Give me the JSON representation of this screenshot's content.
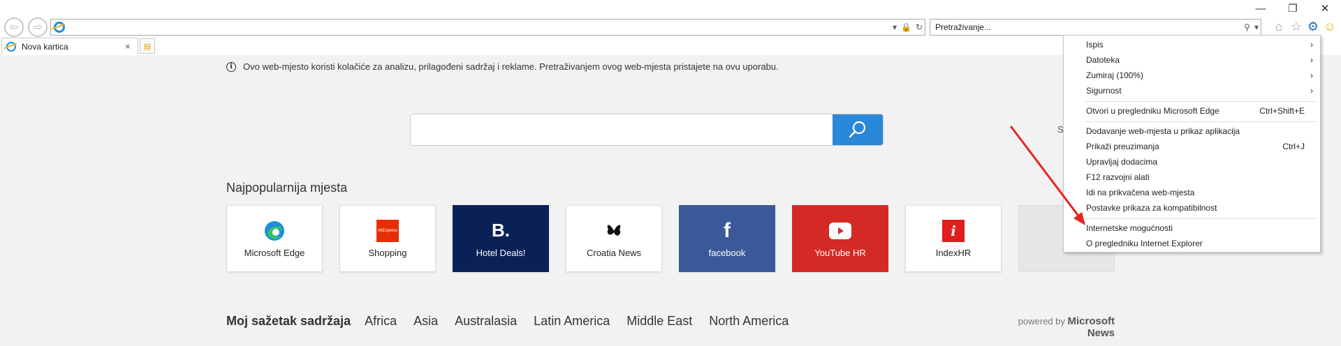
{
  "browser": {
    "address_value": "",
    "search_placeholder": "Pretraživanje...",
    "tab_title": "Nova kartica",
    "tab_close": "×",
    "window_controls": [
      "—",
      "❐",
      "✕"
    ],
    "icons": [
      "back-arrow-icon",
      "forward-arrow-icon",
      "ie-logo-icon",
      "lock-icon",
      "refresh-icon",
      "search-icon",
      "home-icon",
      "favorites-star-icon",
      "gear-icon",
      "smiley-feedback-icon"
    ]
  },
  "page": {
    "cookie_notice": "Ovo web-mjesto koristi kolačiće za analizu, prilagođeni sadržaj i reklame. Pretraživanjem ovog web-mjesta pristajete na ovu uporabu.",
    "search_value": "",
    "top_sites_title": "Najpopularnija mjesta",
    "top_sites": [
      {
        "label": "Microsoft Edge",
        "icon": "edge-icon",
        "color": "#ffffff"
      },
      {
        "label": "Shopping",
        "icon": "aliexpress-icon",
        "color": "#ffffff"
      },
      {
        "label": "Hotel Deals!",
        "icon": "booking-icon",
        "color": "#0a2157"
      },
      {
        "label": "Croatia News",
        "icon": "butterfly-icon",
        "color": "#ffffff"
      },
      {
        "label": "facebook",
        "icon": "facebook-icon",
        "color": "#3b5998"
      },
      {
        "label": "YouTube HR",
        "icon": "youtube-icon",
        "color": "#d42a25"
      },
      {
        "label": "IndexHR",
        "icon": "indexhr-icon",
        "color": "#ffffff"
      }
    ],
    "aliexpress_logo_text": "AliExpress",
    "booking_logo_text": "B.",
    "indexhr_logo_text": "i",
    "search_fragment": "S",
    "feed_lead": "Moj sažetak sadržaja",
    "feed_categories": [
      "Africa",
      "Asia",
      "Australasia",
      "Latin America",
      "Middle East",
      "North America"
    ],
    "powered_prefix": "powered by",
    "powered_brand": "Microsoft News"
  },
  "tools_menu": {
    "items": [
      {
        "label": "Ispis",
        "shortcut": "",
        "submenu": "›"
      },
      {
        "label": "Datoteka",
        "shortcut": "",
        "submenu": "›"
      },
      {
        "label": "Zumiraj (100%)",
        "shortcut": "",
        "submenu": "›"
      },
      {
        "label": "Sigurnost",
        "shortcut": "",
        "submenu": "›"
      },
      {
        "label": "Otvori u pregledniku Microsoft Edge",
        "shortcut": "Ctrl+Shift+E",
        "submenu": ""
      },
      {
        "label": "Dodavanje web-mjesta u prikaz aplikacija",
        "shortcut": "",
        "submenu": ""
      },
      {
        "label": "Prikaži preuzimanja",
        "shortcut": "Ctrl+J",
        "submenu": ""
      },
      {
        "label": "Upravljaj dodacima",
        "shortcut": "",
        "submenu": ""
      },
      {
        "label": "F12 razvojni alati",
        "shortcut": "",
        "submenu": ""
      },
      {
        "label": "Idi na prikvačena web-mjesta",
        "shortcut": "",
        "submenu": ""
      },
      {
        "label": "Postavke prikaza za kompatibilnost",
        "shortcut": "",
        "submenu": ""
      },
      {
        "label": "Internetske mogućnosti",
        "shortcut": "",
        "submenu": ""
      },
      {
        "label": "O pregledniku Internet Explorer",
        "shortcut": "",
        "submenu": ""
      }
    ]
  },
  "annotation": {
    "arrow_color": "#e8231d"
  }
}
